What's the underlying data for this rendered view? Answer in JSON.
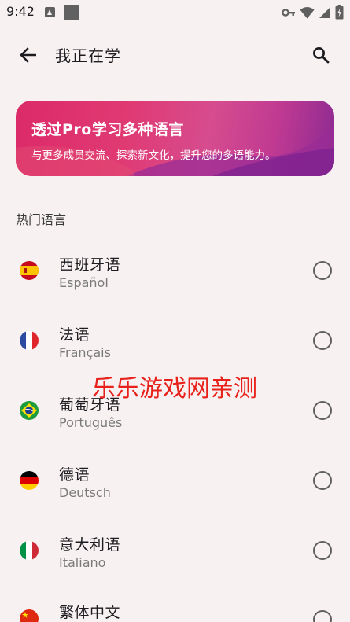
{
  "status_bar": {
    "time": "9:42",
    "icons": [
      "notification-a-icon",
      "notification-square-icon",
      "vpn-key-icon",
      "wifi-icon",
      "signal-icon",
      "battery-icon"
    ]
  },
  "app_bar": {
    "title": "我正在学",
    "back_icon": "arrow-back-icon",
    "search_icon": "search-icon"
  },
  "promo": {
    "title": "透过Pro学习多种语言",
    "subtitle": "与更多成员交流、探索新文化，提升您的多语能力。",
    "colors": [
      "#dc2a68",
      "#d64c8e",
      "#8b2a92"
    ]
  },
  "section_header": "热门语言",
  "languages": [
    {
      "name": "西班牙语",
      "native": "Español",
      "flag": "spain-flag-icon",
      "selected": false
    },
    {
      "name": "法语",
      "native": "Français",
      "flag": "france-flag-icon",
      "selected": false
    },
    {
      "name": "葡萄牙语",
      "native": "Português",
      "flag": "brazil-flag-icon",
      "selected": false
    },
    {
      "name": "德语",
      "native": "Deutsch",
      "flag": "germany-flag-icon",
      "selected": false
    },
    {
      "name": "意大利语",
      "native": "Italiano",
      "flag": "italy-flag-icon",
      "selected": false
    },
    {
      "name": "繁体中文",
      "native": "",
      "flag": "china-flag-icon",
      "selected": false
    }
  ],
  "watermark": "乐乐游戏网亲测"
}
